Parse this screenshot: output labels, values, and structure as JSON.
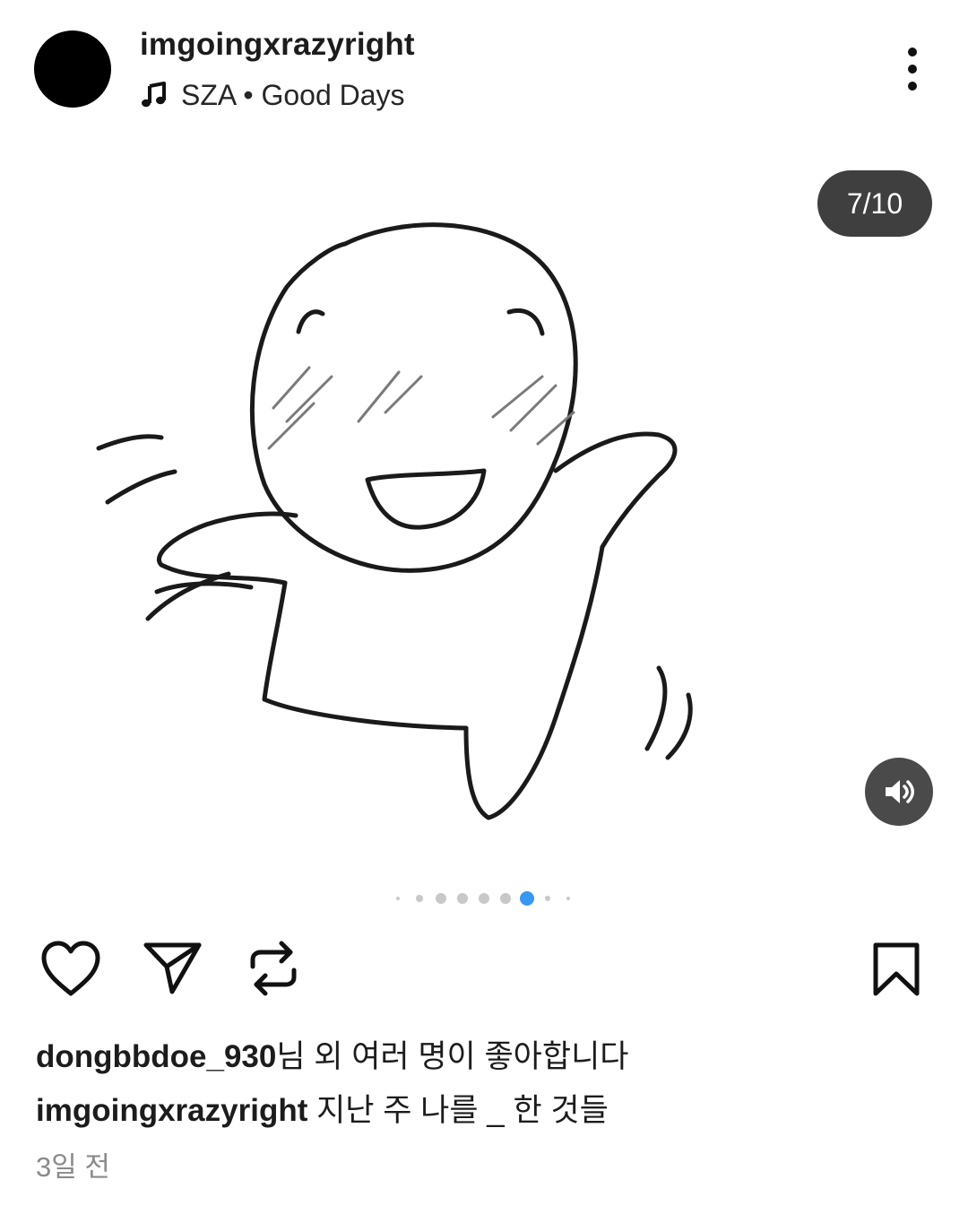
{
  "header": {
    "username": "imgoingxrazyright",
    "music_icon": "music-note-icon",
    "music_text": "SZA • Good Days",
    "more_icon": "more-vertical-icon"
  },
  "media": {
    "counter": "7/10",
    "sound_icon": "speaker-volume-icon",
    "current_slide": 7,
    "total_slides": 10
  },
  "actions": {
    "like_icon": "heart-icon",
    "share_icon": "send-icon",
    "repost_icon": "repost-icon",
    "save_icon": "bookmark-icon"
  },
  "likes": {
    "user": "dongbbdoe_930",
    "suffix": "님 외 여러 명이 좋아합니다"
  },
  "caption": {
    "user": "imgoingxrazyright",
    "text": " 지난 주 나를 _ 한 것들"
  },
  "timestamp": "3일 전",
  "colors": {
    "active_dot": "#3897f0",
    "counter_bg": "#3f3f3f",
    "timestamp": "#8a8a8a"
  }
}
